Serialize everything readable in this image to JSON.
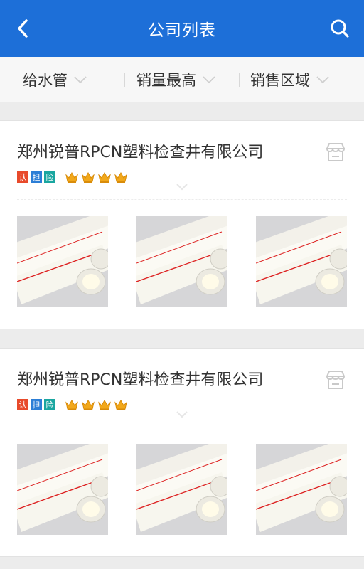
{
  "header": {
    "title": "公司列表",
    "back_icon": "chevron-left-icon",
    "search_icon": "search-icon",
    "color": "#1d6fd8"
  },
  "filters": [
    {
      "label": "给水管"
    },
    {
      "label": "销量最高"
    },
    {
      "label": "销售区域"
    }
  ],
  "companies": [
    {
      "name": "郑州锐普RPCN塑料检查井有限公司",
      "badges": [
        "认",
        "担",
        "险"
      ],
      "crowns": 4,
      "products": [
        "pipe-image",
        "pipe-image",
        "pipe-image"
      ]
    },
    {
      "name": "郑州锐普RPCN塑料检查井有限公司",
      "badges": [
        "认",
        "担",
        "险"
      ],
      "crowns": 4,
      "products": [
        "pipe-image",
        "pipe-image",
        "pipe-image"
      ]
    }
  ]
}
